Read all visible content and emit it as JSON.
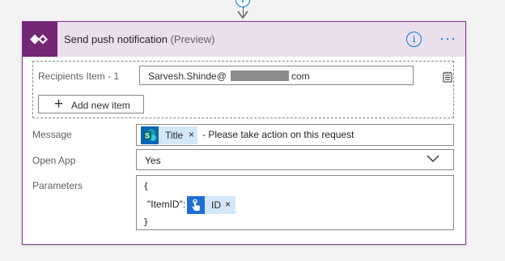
{
  "action": {
    "title": "Send push notification",
    "subtitle": "(Preview)",
    "info_glyph": "i",
    "more_glyph": "···",
    "colors": {
      "brand": "#742774",
      "header_bg": "#ebdfee",
      "accent": "#0078d4",
      "token_bg": "#d4e7f8"
    }
  },
  "connector": {
    "add_glyph": "+"
  },
  "recipients": {
    "label": "Recipients Item - 1",
    "value_prefix": "Sarvesh.Shinde@",
    "value_suffix": "com",
    "add_button": {
      "glyph": "+",
      "label": "Add new item"
    }
  },
  "message": {
    "label": "Message",
    "token": {
      "label": "Title",
      "close": "×",
      "icon": "sharepoint-icon"
    },
    "text": "- Please take action on this request"
  },
  "open_app": {
    "label": "Open App",
    "value": "Yes"
  },
  "parameters": {
    "label": "Parameters",
    "open_brace": "{",
    "key": "\"ItemID\":",
    "token": {
      "label": "ID",
      "close": "×",
      "icon": "touch-icon"
    },
    "close_brace": "}"
  }
}
